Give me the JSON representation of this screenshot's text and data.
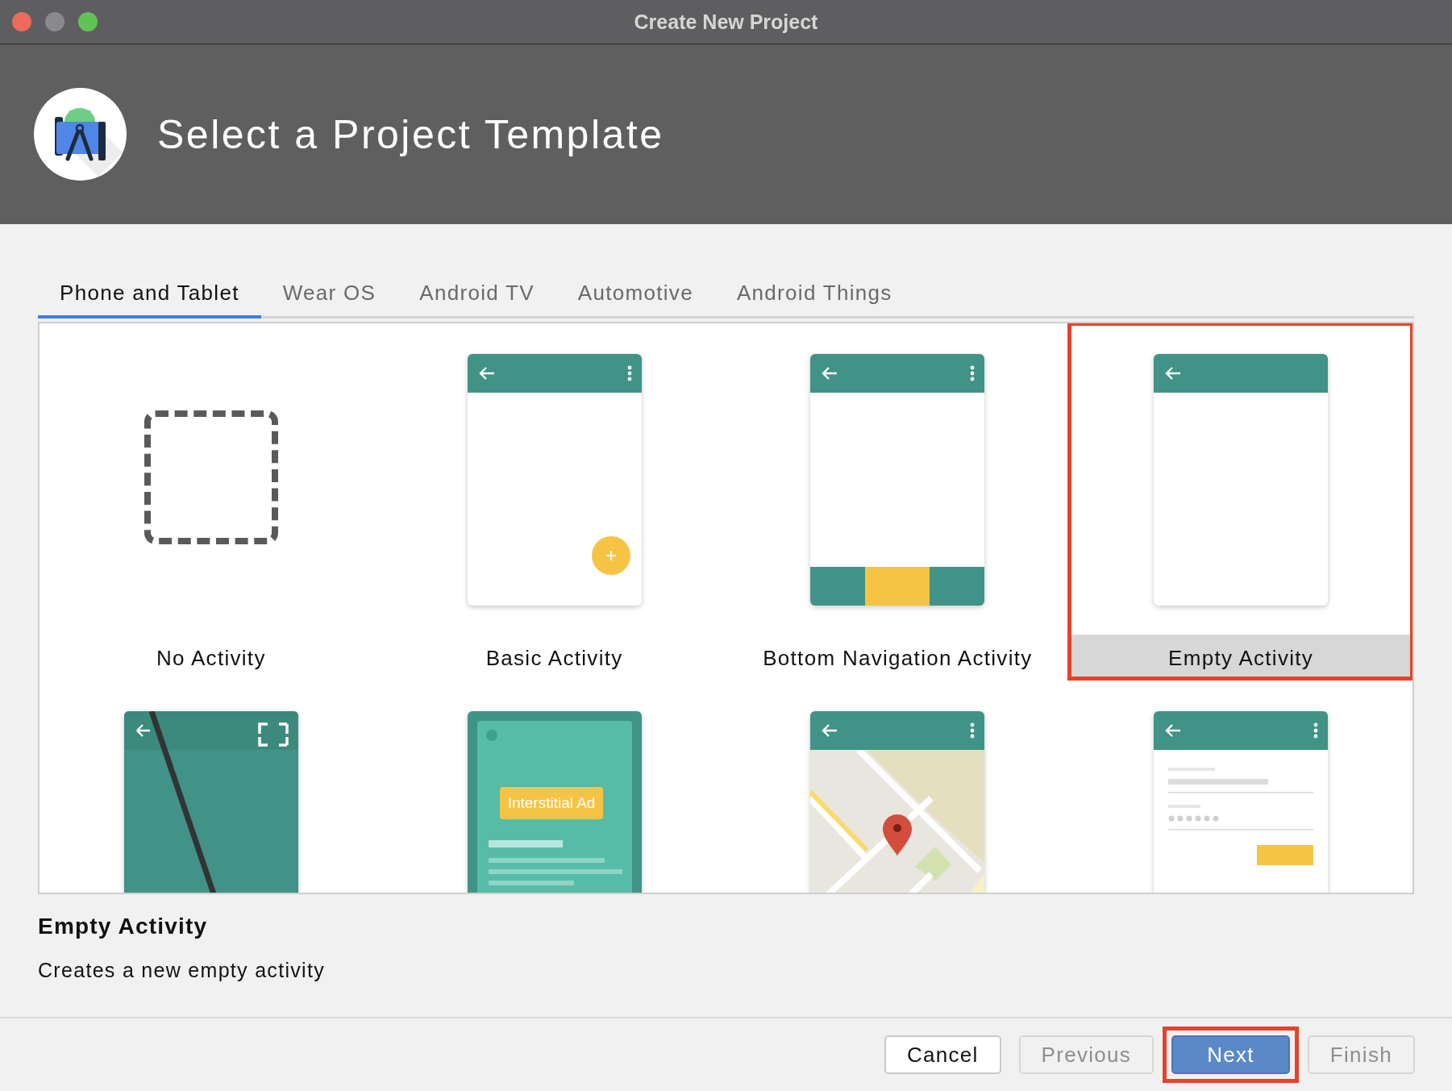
{
  "window": {
    "title": "Create New Project"
  },
  "header": {
    "title": "Select a Project Template"
  },
  "tabs": [
    {
      "label": "Phone and Tablet",
      "selected": true
    },
    {
      "label": "Wear OS",
      "selected": false
    },
    {
      "label": "Android TV",
      "selected": false
    },
    {
      "label": "Automotive",
      "selected": false
    },
    {
      "label": "Android Things",
      "selected": false
    }
  ],
  "templates": [
    {
      "kind": "none",
      "name": "No Activity",
      "selected": false,
      "highlighted": false
    },
    {
      "kind": "basic",
      "name": "Basic Activity",
      "selected": false,
      "highlighted": false
    },
    {
      "kind": "bottomnav",
      "name": "Bottom Navigation Activity",
      "selected": false,
      "highlighted": false
    },
    {
      "kind": "empty",
      "name": "Empty Activity",
      "selected": true,
      "highlighted": true
    },
    {
      "kind": "fullscreen",
      "highlighted": false
    },
    {
      "kind": "interstitial",
      "badge": "Interstitial Ad",
      "highlighted": false
    },
    {
      "kind": "maps",
      "highlighted": false
    },
    {
      "kind": "login",
      "highlighted": false
    }
  ],
  "details": {
    "title": "Empty Activity",
    "description": "Creates a new empty activity"
  },
  "buttons": [
    {
      "label": "Cancel",
      "kind": "default",
      "disabled": false,
      "highlighted": false
    },
    {
      "label": "Previous",
      "kind": "default",
      "disabled": true,
      "highlighted": false
    },
    {
      "label": "Next",
      "kind": "primary",
      "disabled": false,
      "highlighted": true
    },
    {
      "label": "Finish",
      "kind": "default",
      "disabled": true,
      "highlighted": false
    }
  ]
}
